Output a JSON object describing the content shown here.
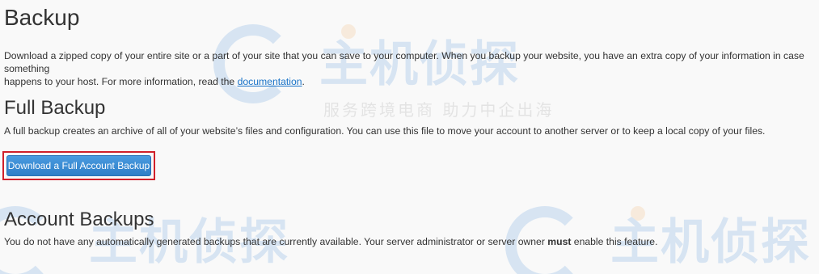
{
  "backup": {
    "title": "Backup",
    "description_part1": "Download a zipped copy of your entire site or a part of your site that you can save to your computer. When you backup your website, you have an extra copy of your information in case something",
    "description_part2": "happens to your host. For more information, read the ",
    "documentation_link": "documentation",
    "description_end": "."
  },
  "full_backup": {
    "title": "Full Backup",
    "description": "A full backup creates an archive of all of your website’s files and configuration. You can use this file to move your account to another server or to keep a local copy of your files.",
    "button_label": "Download a Full Account Backup"
  },
  "account_backups": {
    "title": "Account Backups",
    "description_before": "You do not have any automatically generated backups that are currently available. Your server administrator or server owner ",
    "description_emphasis": "must",
    "description_after": " enable this feature."
  },
  "watermark": {
    "brand": "主机侦探",
    "slogan": "服务跨境电商  助力中企出海"
  },
  "colors": {
    "link": "#1a73c8",
    "button": "#3b8fd6",
    "highlight": "#d0202a"
  }
}
